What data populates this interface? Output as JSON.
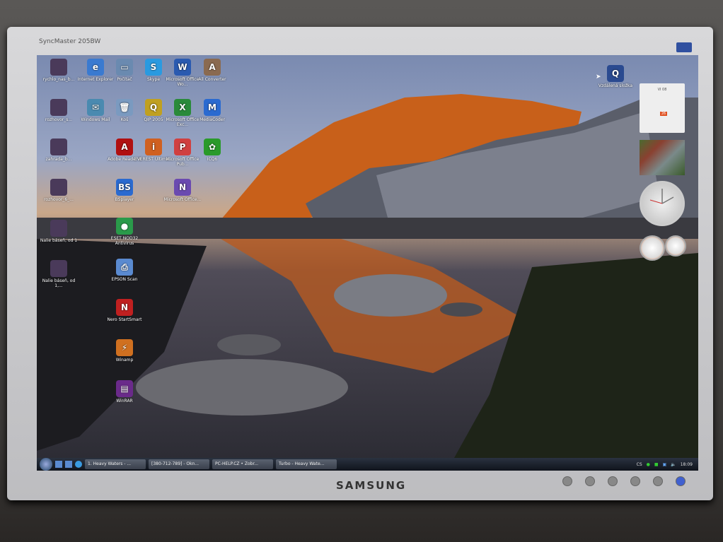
{
  "monitor": {
    "model": "SyncMaster 205BW",
    "brand": "SAMSUNG"
  },
  "desktop": {
    "icons_col0": [
      "rychlo_nas_b...",
      "rozhovor_s...",
      "zahrada_b...",
      "rozhovor_6_...",
      "Nalie báseň, od 1",
      "Nalie báseň, od 1,..."
    ],
    "icons_grid": [
      {
        "label": "Internet Explorer",
        "glyph": "e",
        "color": "#3a7ad0"
      },
      {
        "label": "Počítač",
        "glyph": "▭",
        "color": "#6a8ab0"
      },
      {
        "label": "Skype",
        "glyph": "S",
        "color": "#2a9ae0"
      },
      {
        "label": "Microsoft Office Wo...",
        "glyph": "W",
        "color": "#2a5ab0"
      },
      {
        "label": "All Converter",
        "glyph": "A",
        "color": "#8a6a50"
      },
      {
        "label": "Windows Mail",
        "glyph": "✉",
        "color": "#4a8ab0"
      },
      {
        "label": "Koš",
        "glyph": "🗑",
        "color": "#7a9ac0"
      },
      {
        "label": "QIP 2005",
        "glyph": "Q",
        "color": "#c0a020"
      },
      {
        "label": "Microsoft Office Exc...",
        "glyph": "X",
        "color": "#2a8a3a"
      },
      {
        "label": "MediaCoder",
        "glyph": "M",
        "color": "#2a6ad0"
      },
      {
        "label": "Adobe Reader 8",
        "glyph": "A",
        "color": "#b01010"
      },
      {
        "label": "EVEREST Ultima...",
        "glyph": "i",
        "color": "#d06020"
      },
      {
        "label": "Microsoft Office Pub...",
        "glyph": "P",
        "color": "#d04040"
      },
      {
        "label": "ICQ6",
        "glyph": "✿",
        "color": "#2a9a2a"
      },
      {
        "label": "BSplayer",
        "glyph": "BS",
        "color": "#2a6ad0"
      },
      {
        "label": "Microsoft Office...",
        "glyph": "N",
        "color": "#6a4ab0"
      },
      {
        "label": "ESET NOD32 Antivirus",
        "glyph": "●",
        "color": "#2a9a4a"
      },
      {
        "label": "EPSON Scan",
        "glyph": "⎙",
        "color": "#5a8ad0"
      },
      {
        "label": "Nero StartSmart",
        "glyph": "N",
        "color": "#c02020"
      },
      {
        "label": "Winamp",
        "glyph": "⚡",
        "color": "#d07020"
      },
      {
        "label": "WinRAR",
        "glyph": "▤",
        "color": "#6a2a8a"
      },
      {
        "label": "Vzdálená složka",
        "glyph": "Q",
        "color": "#2a4a90"
      }
    ]
  },
  "gadgets": {
    "calendar_month": "VI 08",
    "calendar_today": "26"
  },
  "taskbar": {
    "tasks": [
      "1. Heavy Waters - ...",
      "[380-712-789] - Okn...",
      "PC-HELP.CZ • Zobr...",
      "Turbo - Heavy Wate..."
    ],
    "language": "CS",
    "clock": "18:09"
  }
}
